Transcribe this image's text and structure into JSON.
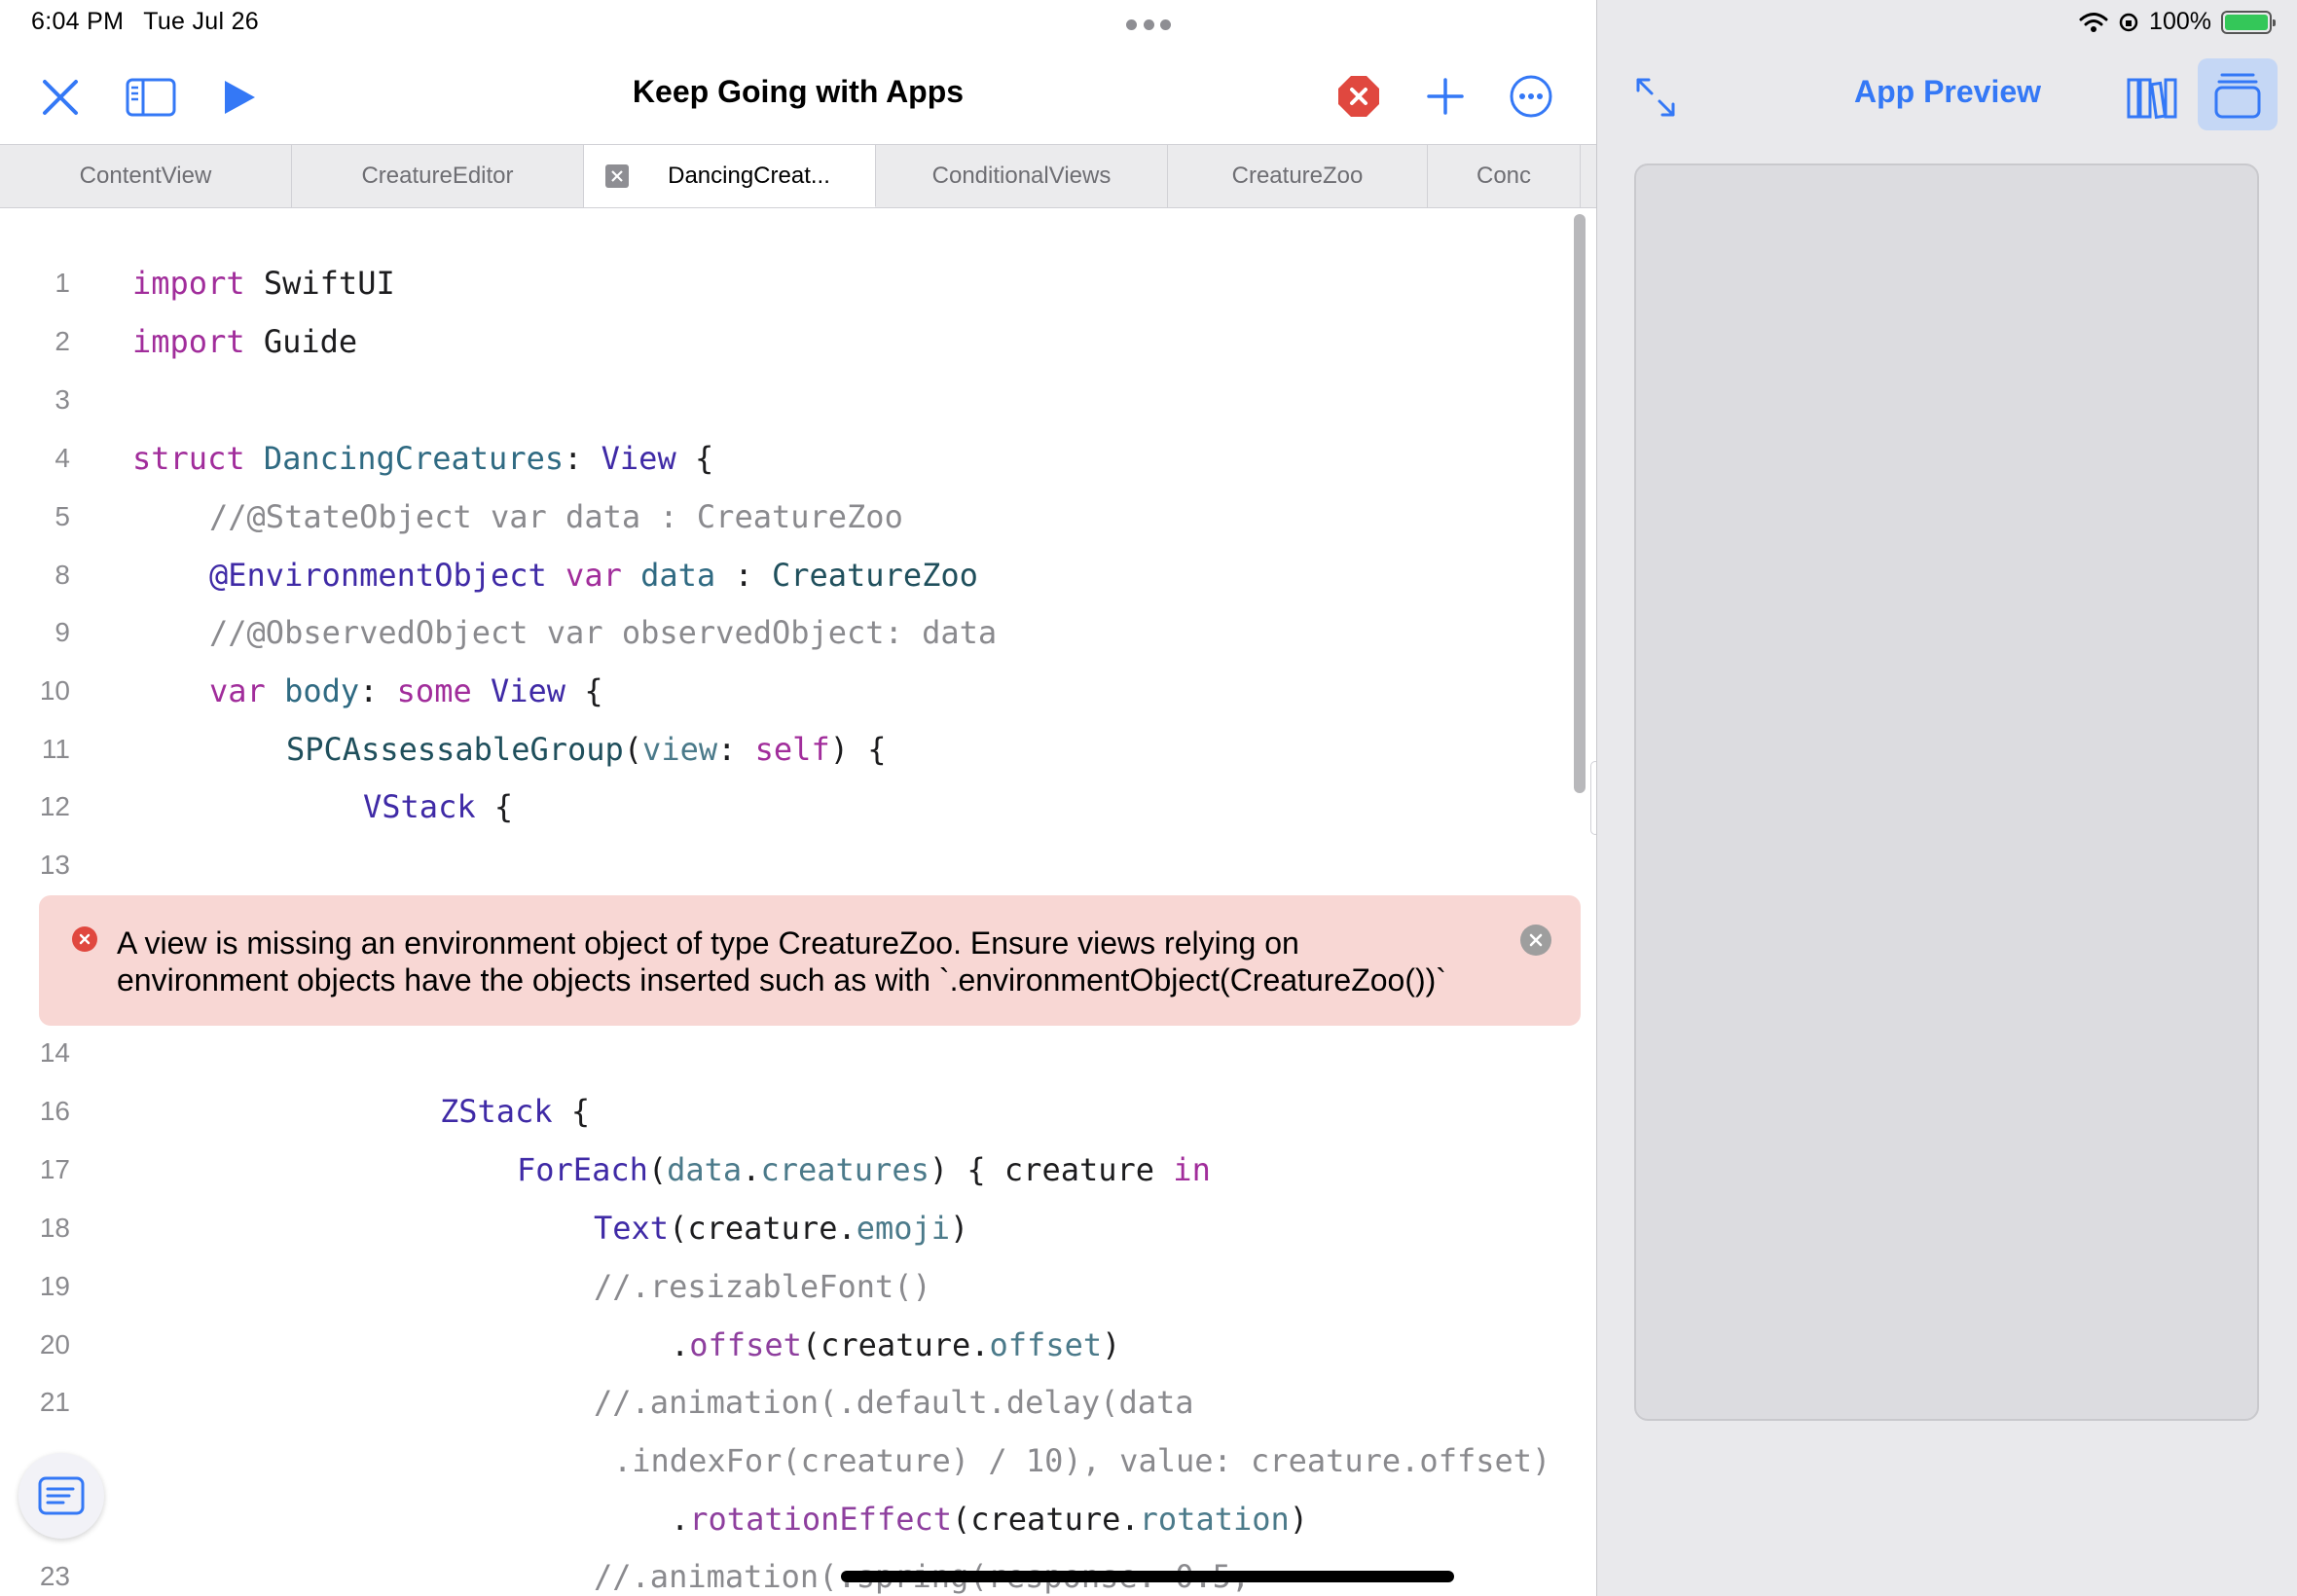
{
  "status_bar": {
    "time": "6:04 PM",
    "date": "Tue Jul 26",
    "battery": "100%"
  },
  "toolbar": {
    "title": "Keep Going with Apps",
    "icons": [
      "close-icon",
      "sidebar-icon",
      "run-icon",
      "error-icon",
      "add-icon",
      "more-icon"
    ]
  },
  "tabs": [
    {
      "label": "ContentView"
    },
    {
      "label": "CreatureEditor"
    },
    {
      "label": "DancingCreat..."
    },
    {
      "label": "ConditionalViews"
    },
    {
      "label": "CreatureZoo"
    },
    {
      "label": "Conc"
    }
  ],
  "code": {
    "line_numbers": [
      "1",
      "2",
      "3",
      "4",
      "5",
      "8",
      "9",
      "10",
      "11",
      "12",
      "13",
      "14",
      "16",
      "17",
      "18",
      "19",
      "20",
      "21",
      "23"
    ]
  },
  "error": {
    "message_line1": "A view is missing an environment object of type CreatureZoo. Ensure views relying on",
    "message_line2": "environment objects have the objects inserted such as with `.environmentObject(CreatureZoo())`"
  },
  "preview": {
    "title": "App Preview",
    "icons": [
      "expand-icon",
      "library-icon",
      "layers-icon"
    ]
  },
  "colors": {
    "accent": "#3478f6",
    "error": "#e0483f",
    "error_background": "#f8d7d4",
    "keyword": "#a12d9b",
    "type": "#3f2aa6"
  }
}
